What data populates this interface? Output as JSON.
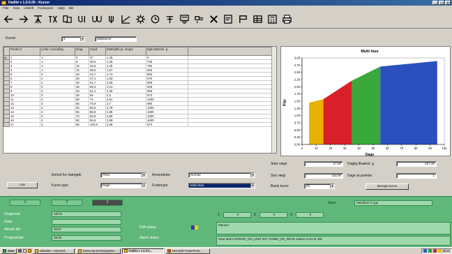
{
  "window": {
    "title": "Fødikt v 1.0.0.00 - Kurver"
  },
  "menu": [
    "Filer",
    "Data",
    "Utskrift",
    "Funksjoner",
    "Hjelp",
    "Bkt"
  ],
  "toolbar_icons": [
    "back-arrow-icon",
    "forward-arrow-icon",
    "dam-icon",
    "weather-icon",
    "sheets-icon",
    "valve-icon",
    "hydrograph-icon",
    "turbine-icon",
    "curve-icon",
    "gear-icon",
    "clock-icon",
    "station-icon",
    "form-icon",
    "cross-section-icon",
    "close-icon",
    "document-icon",
    "flag-icon",
    "table-icon",
    "calculator-icon",
    "printer-icon"
  ],
  "selector": {
    "label": "Kurver",
    "number": "3",
    "name": "Multikurve"
  },
  "table": {
    "columns": [
      "Punkt nr.",
      "Linhe 1 Kavnling",
      "Drag",
      "Høyd",
      "Materjalle pr. meget",
      "Dgb Materiel .g"
    ],
    "rows": [
      [
        "1",
        "1",
        "0",
        "27",
        "1,45",
        "0"
      ],
      [
        "2",
        "1",
        "5",
        "30,5",
        "1,45",
        "725"
      ],
      [
        "3",
        "1",
        "10",
        "34,5",
        "1,45",
        "750"
      ],
      [
        "4",
        "1",
        "15",
        "38,5",
        "1,57",
        "825"
      ],
      [
        "5",
        "2",
        "20",
        "42,7",
        "1,74",
        "883"
      ],
      [
        "6",
        "2",
        "25",
        "47,1",
        "1,93",
        "975"
      ],
      [
        "7",
        "2",
        "30",
        "51,7",
        "2,08",
        "900"
      ],
      [
        "8",
        "2",
        "35",
        "56,3",
        "2,21",
        "918"
      ],
      [
        "9",
        "3",
        "40",
        "61,1",
        "2,36",
        "965"
      ],
      [
        "10",
        "3",
        "45",
        "66",
        "2,5",
        "973"
      ],
      [
        "11",
        "3",
        "50",
        "71",
        "2,61",
        "1000"
      ],
      [
        "12",
        "3",
        "55",
        "75,9",
        "2,7",
        "980"
      ],
      [
        "13",
        "4",
        "60",
        "80,9",
        "2,78",
        "1000"
      ],
      [
        "14",
        "4",
        "65",
        "85,9",
        "2,85",
        "1000"
      ],
      [
        "15",
        "4",
        "70",
        "90,9",
        "2,88",
        "1000"
      ],
      [
        "16",
        "4",
        "80",
        "95,8",
        "2,89",
        "1000"
      ],
      [
        "17",
        "4",
        "90",
        "100,8",
        "2,89",
        "974"
      ]
    ]
  },
  "chart_data": {
    "type": "area",
    "title": "Multi fase",
    "xlabel": "Dage",
    "ylabel": "Fôr",
    "xlim": [
      0,
      100
    ],
    "ylim": [
      0,
      3
    ],
    "x_ticks": [
      0,
      10,
      20,
      30,
      40,
      50,
      60,
      70,
      80,
      90,
      100
    ],
    "y_ticks": [
      "0,00",
      "0,25",
      "0,50",
      "0,75",
      "1,00",
      "1,25",
      "1,50",
      "1,75",
      "2,00",
      "2,25",
      "2,50",
      "2,75",
      "3,00"
    ],
    "series": [
      {
        "color": "#e8b000",
        "x": [
          5,
          15
        ],
        "y": [
          1.45,
          1.57
        ]
      },
      {
        "color": "#d8202a",
        "x": [
          15,
          35
        ],
        "y": [
          1.57,
          2.21
        ]
      },
      {
        "color": "#3aa83a",
        "x": [
          35,
          55
        ],
        "y": [
          2.21,
          2.7
        ]
      },
      {
        "color": "#2a50c0",
        "x": [
          55,
          95
        ],
        "y": [
          2.7,
          2.89
        ]
      }
    ]
  },
  "form": {
    "left": {
      "enhed_label": "Enhed for mængde",
      "enhed_value": "FEsv",
      "kurve_label": "Kurve type",
      "kurve_value": "Dage",
      "ok_button": "Luk"
    },
    "middle": {
      "anvendelse_label": "Anvendelse",
      "anvendelse_value": "Normal",
      "fodertype_label": "Fodertype",
      "fodertype_value": "Multi fase"
    },
    "right": {
      "start_vaegt_label": "Start vægt",
      "start_vaegt_value": "27,00",
      "slut_vaegt_label": "Slut vægt",
      "slut_vaegt_value": "115,00",
      "basis_label": "Basis kurve",
      "basis_value": "20",
      "daglig_label": "Daglig tilvækst .g",
      "daglig_value": "827,30",
      "dage_label": "Dage at punkter",
      "dage_value": "1",
      "beregn_button": "Beregn kurve"
    }
  },
  "status": {
    "tabs": [
      "1",
      "2",
      "3"
    ],
    "navn_label": "Navn",
    "navn_value": "Mastdore 3 uge",
    "diagnosis_label": "Diagnose",
    "diagnosis_value": "admin",
    "data_label": "Data",
    "data_value": "",
    "aktuel_label": "Aktuel tid",
    "aktuel_value": "08:57",
    "program_label": "Programtør",
    "program_value": "09:00",
    "drift_label": "Drift status",
    "alarm_label": "Alarm status",
    "counters": [
      {
        "label": "1",
        "value": "0"
      },
      {
        "label": "2",
        "value": "0"
      },
      {
        "label": "3",
        "value": "0"
      }
    ],
    "manuel_value": "Manuel",
    "message_value": "Start alarm ERROR_ON_UNIT 007 COMM_ON_READ Status Arms til 200"
  },
  "taskbar": {
    "start": "Start",
    "tasks": [
      "Indbakke - Microsof...",
      "Samsung ECDisplayDim...",
      "Fødikt v 1.0.0.0...",
      "Microsoft PowerPoint..."
    ],
    "active_index": 2,
    "clock": "09:21"
  }
}
